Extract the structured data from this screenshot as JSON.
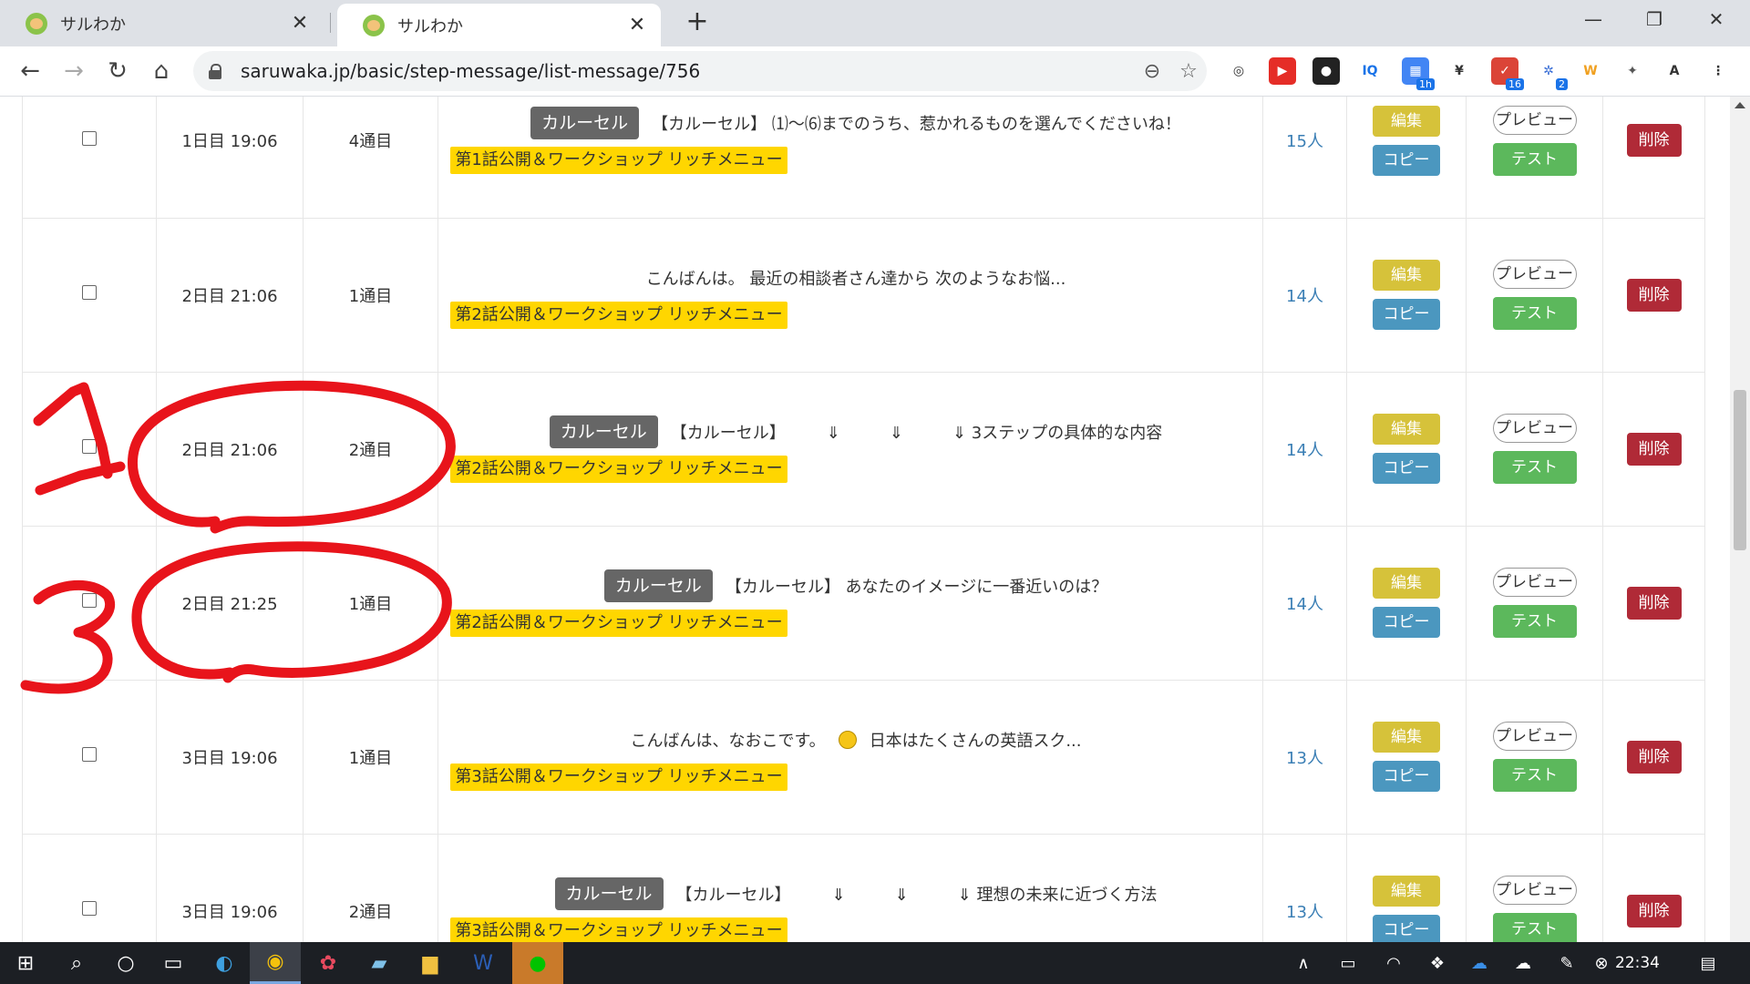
{
  "browser": {
    "tabs": [
      {
        "title": "サルわか",
        "active": false
      },
      {
        "title": "サルわか",
        "active": true
      }
    ],
    "new_tab": "+",
    "window_controls": {
      "minimize": "—",
      "restore": "❐",
      "close": "✕"
    },
    "url": "saruwaka.jp/basic/step-message/list-message/756",
    "extensions": [
      {
        "name": "scan-icon",
        "label": "◎",
        "color": "#ffffff",
        "text": "#333333"
      },
      {
        "name": "youtube-icon",
        "label": "▶",
        "color": "#e52d27",
        "text": "#ffffff"
      },
      {
        "name": "ext-icon",
        "label": "●",
        "color": "#222222",
        "text": "#ffffff"
      },
      {
        "name": "iq-icon",
        "label": "IQ",
        "color": "#ffffff",
        "text": "#1a73e8"
      },
      {
        "name": "calendar-icon",
        "label": "▦",
        "color": "#4285f4",
        "text": "#ffffff",
        "badge": "1h"
      },
      {
        "name": "yen-icon",
        "label": "¥",
        "color": "#ffffff",
        "text": "#333333"
      },
      {
        "name": "todo-icon",
        "label": "✓",
        "color": "#db4437",
        "text": "#ffffff",
        "badge": "16"
      },
      {
        "name": "gear-ext-icon",
        "label": "✲",
        "color": "#ffffff",
        "text": "#3b6fd6",
        "badge": "2"
      },
      {
        "name": "w-icon",
        "label": "W",
        "color": "#ffffff",
        "text": "#f0a020"
      },
      {
        "name": "puzzle-icon",
        "label": "✦",
        "color": "#ffffff",
        "text": "#555555"
      },
      {
        "name": "profile-icon",
        "label": "A",
        "color": "#ffffff",
        "text": "#333333"
      },
      {
        "name": "menu-icon",
        "label": "⋮",
        "color": "#ffffff",
        "text": "#333333"
      }
    ]
  },
  "buttons": {
    "edit": "編集",
    "copy": "コピー",
    "preview": "プレビュー",
    "test": "テスト",
    "delete": "削除"
  },
  "rows": [
    {
      "day": "1日目 19:06",
      "nth": "4通目",
      "carousel": "カルーセル",
      "text": "【カルーセル】 ⑴〜⑹までのうち、惹かれるものを選んでくださいね！",
      "tag": "第1話公開＆ワークショップ リッチメニュー",
      "count": "15人"
    },
    {
      "day": "2日目 21:06",
      "nth": "1通目",
      "carousel": "",
      "text": "こんばんは。 最近の相談者さん達から 次のようなお悩...",
      "tag": "第2話公開＆ワークショップ リッチメニュー",
      "count": "14人"
    },
    {
      "day": "2日目 21:06",
      "nth": "2通目",
      "carousel": "カルーセル",
      "text": "【カルーセル】　　　⇓　　　⇓　　　⇓ 3ステップの具体的な内容",
      "tag": "第2話公開＆ワークショップ リッチメニュー",
      "count": "14人"
    },
    {
      "day": "2日目 21:25",
      "nth": "1通目",
      "carousel": "カルーセル",
      "text": "【カルーセル】 あなたのイメージに一番近いのは？",
      "tag": "第2話公開＆ワークショップ リッチメニュー",
      "count": "14人"
    },
    {
      "day": "3日目 19:06",
      "nth": "1通目",
      "carousel": "",
      "text": "こんばんは、なおこです。",
      "text_after_emoji": "日本はたくさんの英語スク...",
      "tag": "第3話公開＆ワークショップ リッチメニュー",
      "count": "13人"
    },
    {
      "day": "3日目 19:06",
      "nth": "2通目",
      "carousel": "カルーセル",
      "text": "【カルーセル】　　　⇓　　　⇓　　　⇓ 理想の未来に近づく方法",
      "tag": "第3話公開＆ワークショップ リッチメニュー",
      "count": "13人"
    }
  ],
  "annotations": {
    "numbers": [
      "1",
      "3"
    ],
    "color": "#e8141b"
  },
  "taskbar": {
    "clock": "22:34"
  },
  "colors": {
    "edit": "#d6c23a",
    "copy": "#4b97bf",
    "test": "#5cb85c",
    "delete": "#b02a37",
    "tag": "#ffd600",
    "carousel": "#666666",
    "count": "#3b7fb5"
  }
}
